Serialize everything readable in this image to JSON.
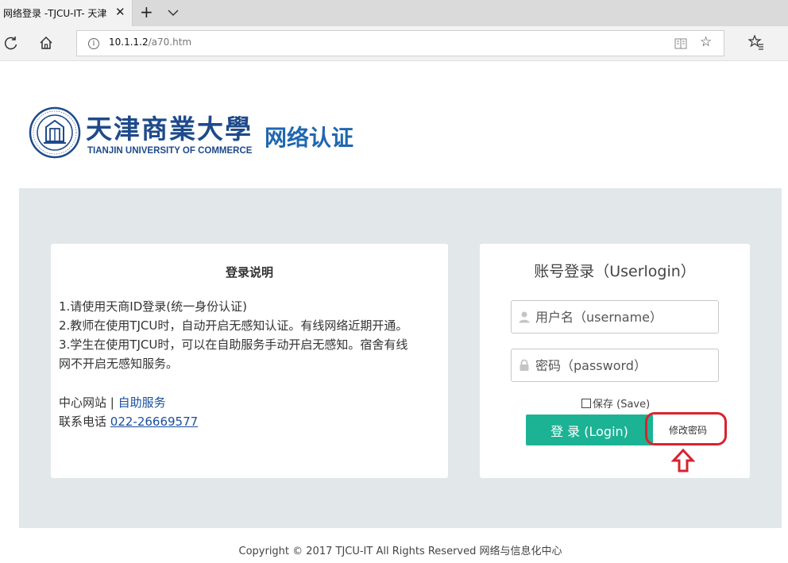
{
  "browser": {
    "tab_title": "网络登录 -TJCU-IT- 天津",
    "tab_close": "✕",
    "new_tab": "+",
    "url_host": "10.1.1.2",
    "url_path": "/a70.htm",
    "info_glyph": "i",
    "star_glyph": "☆"
  },
  "header": {
    "logo_cn": "天津商業大學",
    "logo_en": "TIANJIN UNIVERSITY OF COMMERCE",
    "subtitle": "网络认证"
  },
  "instructions": {
    "title": "登录说明",
    "lines": [
      "1.请使用天商ID登录(统一身份认证)",
      "2.教师在使用TJCU时，自动开启无感知认证。有线网络近期开通。",
      "3.学生在使用TJCU时，可以在自助服务手动开启无感知。宿舍有线",
      "网不开启无感知服务。"
    ],
    "center_site": "中心网站",
    "separator": " | ",
    "self_service": "自助服务",
    "phone_label": "联系电话 ",
    "phone_number": "022-26669577"
  },
  "login": {
    "title": "账号登录（Userlogin）",
    "username_placeholder": "用户名（username）",
    "password_placeholder": "密码（password）",
    "save_label": "保存 (Save)",
    "save_checked": false,
    "login_button": "登 录 (Login)",
    "change_password": "修改密码"
  },
  "footer": {
    "copyright": "Copyright © 2017 TJCU-IT All Rights Reserved 网络与信息化中心"
  },
  "colors": {
    "brand_blue": "#1e4a8a",
    "link_blue": "#1a4f9c",
    "login_green": "#1bb394",
    "panel_gray": "#e2e7e9",
    "annotation_red": "#d9232d"
  },
  "icons": [
    "refresh-icon",
    "home-icon",
    "info-icon",
    "reading-view-icon",
    "star-icon",
    "favorites-icon",
    "user-icon",
    "lock-icon",
    "up-arrow-icon",
    "close-icon",
    "chevron-down-icon",
    "university-emblem"
  ]
}
